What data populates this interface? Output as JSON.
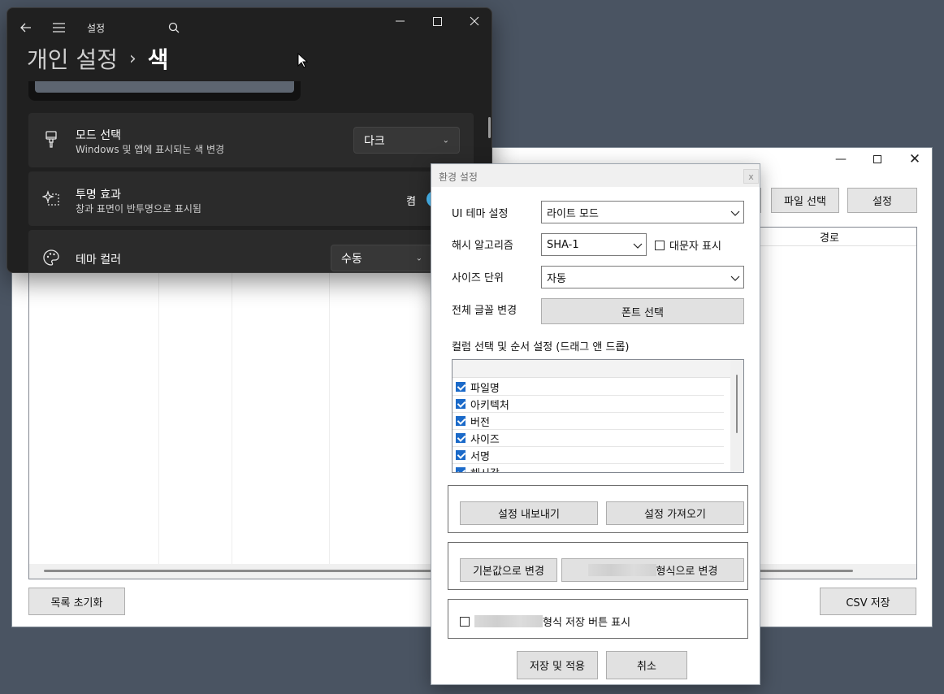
{
  "main_window": {
    "top_buttons": {
      "file_select": "파일 선택",
      "settings": "설정"
    },
    "columns": {
      "path": "경로"
    },
    "bottom_buttons": {
      "reset_list": "목록 초기화",
      "save_csv": "CSV 저장"
    }
  },
  "settings_app": {
    "app_title": "설정",
    "breadcrumb": {
      "parent": "개인 설정",
      "separator": "›",
      "current": "색"
    },
    "rows": {
      "mode": {
        "title": "모드 선택",
        "subtitle": "Windows 및 앱에 표시되는 색 변경",
        "value": "다크"
      },
      "transparency": {
        "title": "투명 효과",
        "subtitle": "창과 표면이 반투명으로 표시됨",
        "toggle_label": "켬",
        "toggle_on": true
      },
      "accent": {
        "title": "테마 컬러",
        "value": "수동"
      }
    }
  },
  "dialog": {
    "title": "환경 설정",
    "close": "x",
    "ui_theme": {
      "label": "UI 테마 설정",
      "value": "라이트 모드"
    },
    "hash": {
      "label": "해시 알고리즘",
      "value": "SHA-1",
      "uppercase_label": "대문자 표시",
      "uppercase_checked": false
    },
    "size_unit": {
      "label": "사이즈 단위",
      "value": "자동"
    },
    "font": {
      "label": "전체 글꼴 변경",
      "button": "폰트 선택"
    },
    "columns_section": {
      "label": "컬럼 선택 및 순서 설정 (드래그 앤 드롭)",
      "items": [
        {
          "label": "파일명",
          "checked": true
        },
        {
          "label": "아키텍처",
          "checked": true
        },
        {
          "label": "버전",
          "checked": true
        },
        {
          "label": "사이즈",
          "checked": true
        },
        {
          "label": "서명",
          "checked": true
        },
        {
          "label": "해시값",
          "checked": true
        }
      ]
    },
    "export_button": "설정 내보내기",
    "import_button": "설정 가져오기",
    "default_button": "기본값으로 변경",
    "format_change_suffix": "형식으로 변경",
    "format_save_label": "형식 저장 버튼 표시",
    "format_save_checked": false,
    "save_apply_button": "저장 및 적용",
    "cancel_button": "취소"
  }
}
